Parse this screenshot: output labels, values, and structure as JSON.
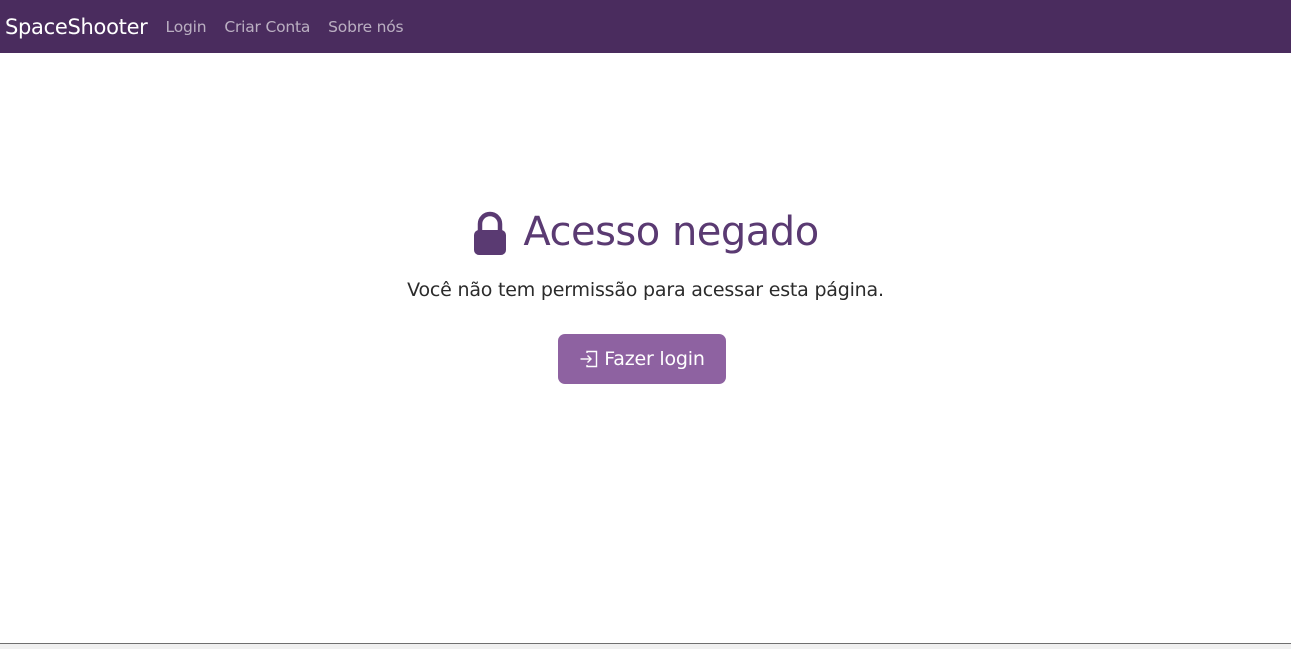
{
  "navbar": {
    "brand": "SpaceShooter",
    "links": [
      "Login",
      "Criar Conta",
      "Sobre nós"
    ]
  },
  "main": {
    "title": "Acesso negado",
    "message": "Você não tem permissão para acessar esta página.",
    "button_label": "Fazer login",
    "title_icon": "lock-icon",
    "button_icon": "login-icon"
  },
  "colors": {
    "navbar_bg": "#4a2c5e",
    "title": "#5a3a72",
    "button_bg": "#8e62a1"
  }
}
